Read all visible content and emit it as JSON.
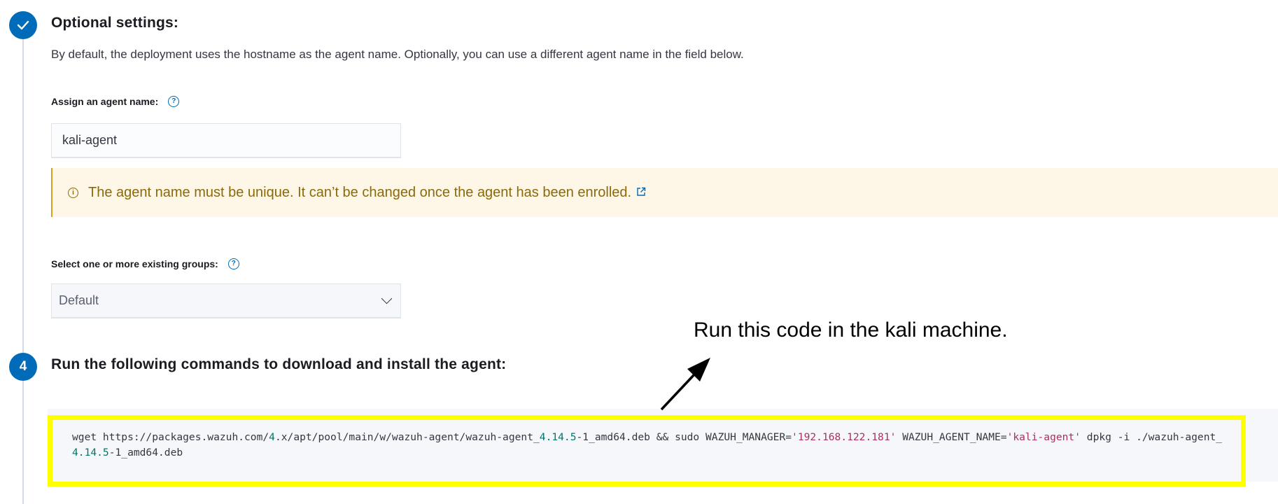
{
  "step3": {
    "title": "Optional settings:",
    "description": "By default, the deployment uses the hostname as the agent name. Optionally, you can use a different agent name in the field below."
  },
  "agent_name": {
    "label": "Assign an agent name:",
    "value": "kali-agent"
  },
  "callout": {
    "text": "The agent name must be unique. It can’t be changed once the agent has been enrolled."
  },
  "groups": {
    "label": "Select one or more existing groups:",
    "selected": "Default"
  },
  "step4": {
    "number": "4",
    "title": "Run the following commands to download and install the agent:"
  },
  "command": {
    "p1": "wget https://packages.wazuh.com/",
    "v1": "4",
    "p2": ".x/apt/pool/main/w/wazuh-agent/wazuh-agent_",
    "v2": "4.14.5",
    "p3": "-1_amd64.deb && sudo WAZUH_MANAGER=",
    "s1": "'192.168.122.181'",
    "p4": " WAZUH_AGENT_NAME=",
    "s2": "'kali-agent'",
    "p5": " dpkg -i ./wazuh-agent_",
    "v3": "4.14.5",
    "p6": "-1_amd64.deb"
  },
  "annotation": {
    "text": "Run this code in the kali machine."
  },
  "colors": {
    "accent": "#006bb8",
    "highlight": "#ffff00",
    "warning_bg": "#fef6e6",
    "string": "#a8315f",
    "number": "#00766b"
  },
  "icons": [
    "check-icon",
    "help-icon",
    "info-icon",
    "external-link-icon",
    "chevron-down-icon",
    "arrow-icon"
  ]
}
